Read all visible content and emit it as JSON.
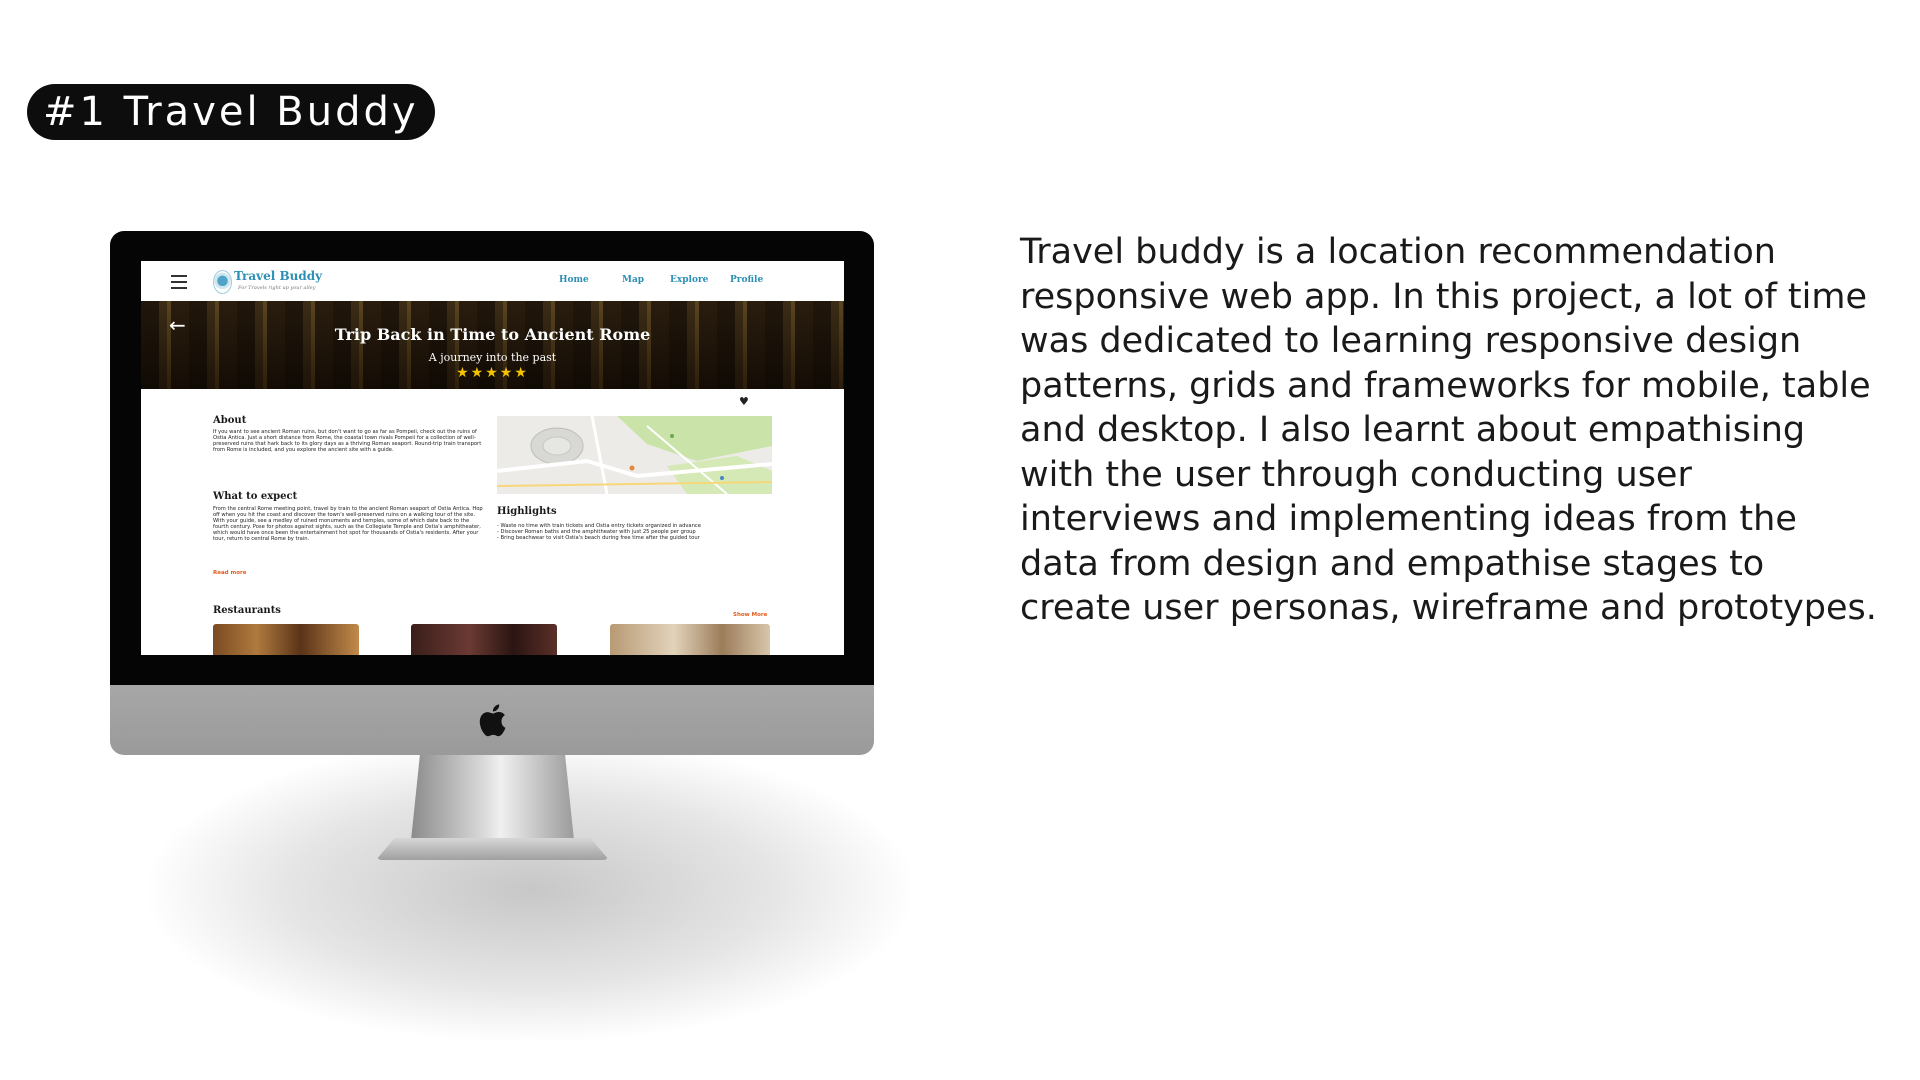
{
  "slide": {
    "title": "#1 Travel Buddy",
    "description": "Travel buddy is a location recommendation responsive web app. In this project, a lot of time was dedicated to learning responsive design patterns, grids and frameworks for mobile, table and desktop. I also learnt about empathising with the user through conducting user interviews and implementing ideas from the data from design and empathise stages to create user personas, wireframe and prototypes."
  },
  "app": {
    "logo_name": "Travel Buddy",
    "logo_tagline": "For Travels right up your alley",
    "nav": [
      "Home",
      "Map",
      "Explore",
      "Profile"
    ],
    "hero": {
      "title": "Trip Back in Time to Ancient Rome",
      "subtitle": "A journey into the past",
      "stars": "★★★★★",
      "rating": 5
    },
    "about": {
      "heading": "About",
      "body": "If you want to see ancient Roman ruins, but don't want to go as far as Pompeii, check out the ruins of Ostia Antica. Just a short distance from Rome, the coastal town rivals Pompeii for a collection of well-preserved ruins that hark back to its glory days as a thriving Roman seaport. Round-trip train transport from Rome is included, and you explore the ancient site with a guide."
    },
    "expect": {
      "heading": "What to expect",
      "body": "From the central Rome meeting point, travel by train to the ancient Roman seaport of Ostia Antica. Hop off when you hit the coast and discover the town's well-preserved ruins on a walking tour of the site. With your guide, see a medley of ruined monuments and temples, some of which date back to the fourth century. Pose for photos against sights, such as the Collegiate Temple and Ostia's amphitheater, which would have once been the entertainment hot spot for thousands of Ostia's residents. After your tour, return to central Rome by train.",
      "read_more": "Read more"
    },
    "highlights": {
      "heading": "Highlights",
      "items": [
        "- Waste no time with train tickets and Ostia entry tickets organized in advance",
        "- Discover Roman baths and the amphitheater with just 25 people per group",
        "- Bring beachwear to visit Ostia's beach during free time after the guided tour"
      ]
    },
    "restaurants": {
      "heading": "Restaurants",
      "show_more": "Show More"
    }
  },
  "colors": {
    "accent": "#2c8fb4",
    "link_orange": "#e05b1b",
    "star": "#f4c400"
  }
}
